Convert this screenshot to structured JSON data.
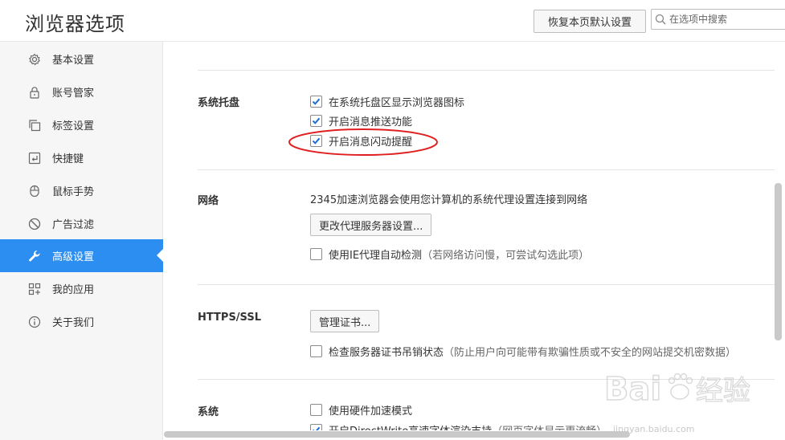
{
  "header": {
    "title": "浏览器选项",
    "reset_label": "恢复本页默认设置",
    "search_placeholder": "在选项中搜索"
  },
  "sidebar": {
    "items": [
      {
        "label": "基本设置",
        "icon": "gear-icon"
      },
      {
        "label": "账号管家",
        "icon": "lock-icon"
      },
      {
        "label": "标签设置",
        "icon": "tabs-icon"
      },
      {
        "label": "快捷键",
        "icon": "keyboard-icon"
      },
      {
        "label": "鼠标手势",
        "icon": "mouse-icon"
      },
      {
        "label": "广告过滤",
        "icon": "block-icon"
      },
      {
        "label": "高级设置",
        "icon": "wrench-icon",
        "active": true
      },
      {
        "label": "我的应用",
        "icon": "apps-icon"
      },
      {
        "label": "关于我们",
        "icon": "info-icon"
      }
    ],
    "active_color": "#2b8ef0"
  },
  "content": {
    "tray": {
      "label": "系统托盘",
      "options": [
        {
          "label": "在系统托盘区显示浏览器图标",
          "checked": true
        },
        {
          "label": "开启消息推送功能",
          "checked": true
        },
        {
          "label": "开启消息闪动提醒",
          "checked": true
        }
      ]
    },
    "network": {
      "label": "网络",
      "desc": "2345加速浏览器会使用您计算机的系统代理设置连接到网络",
      "proxy_button": "更改代理服务器设置...",
      "ie_proxy": {
        "label": "使用IE代理自动检测",
        "hint": "（若网络访问慢，可尝试勾选此项）",
        "checked": false
      }
    },
    "https": {
      "label": "HTTPS/SSL",
      "cert_button": "管理证书...",
      "revocation": {
        "label": "检查服务器证书吊销状态",
        "hint": "（防止用户向可能带有欺骗性质或不安全的网站提交机密数据）",
        "checked": false
      }
    },
    "system": {
      "label": "系统",
      "hw_accel": {
        "label": "使用硬件加速模式",
        "checked": false
      },
      "directwrite": {
        "label": "开启DirectWrite高速字体渲染支持",
        "hint": "（网页字体显示更流畅）",
        "checked": true
      }
    }
  },
  "annotation_color": "#e02020",
  "watermark": {
    "brand": "Baidu经验",
    "url": "jingyan.baidu.com"
  }
}
